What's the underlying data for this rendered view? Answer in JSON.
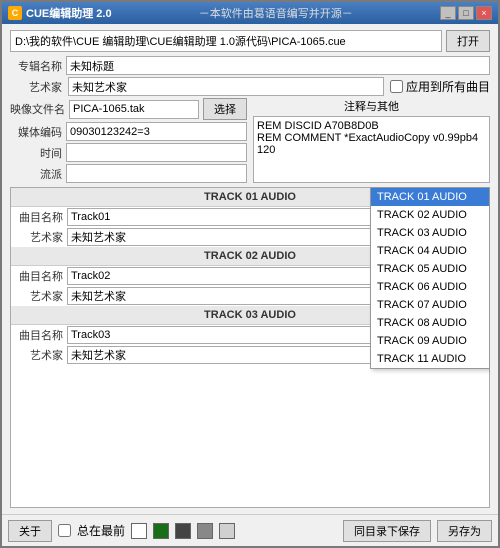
{
  "window": {
    "title": "CUE编辑助理 2.0",
    "subtitle": "－本软件由葛语音编写并开源－",
    "buttons": [
      "_",
      "□",
      "×"
    ]
  },
  "file_path": "D:\\我的软件\\CUE 编辑助理\\CUE编辑助理 1.0源代码\\PICA-1065.cue",
  "open_btn": "打开",
  "fields": {
    "album_label": "专辑名称",
    "album_value": "未知标题",
    "artist_label": "艺术家",
    "artist_value": "未知艺术家",
    "apply_label": "应用到所有曲目",
    "image_label": "映像文件名",
    "image_value": "PICA-1065.tak",
    "select_btn": "选择",
    "media_label": "媒体编码",
    "media_value": "09030123242=3",
    "notes_label": "注释与其他",
    "notes_value": "REM DISCID A70B8D0B\nREM COMMENT *ExactAudioCopy v0.99pb4\n120",
    "time_label": "时间",
    "time_value": "",
    "genre_label": "流派",
    "genre_value": ""
  },
  "tracks": [
    {
      "header": "TRACK 01 AUDIO",
      "name_label": "曲目名称",
      "name_value": "Track01",
      "artist_label": "艺术家",
      "artist_value": "未知艺术家"
    },
    {
      "header": "TRACK 02 AUDIO",
      "name_label": "曲目名称",
      "name_value": "Track02",
      "artist_label": "艺术家",
      "artist_value": "未知艺术家"
    },
    {
      "header": "TRACK 03 AUDIO",
      "name_label": "曲目名称",
      "name_value": "Track03",
      "artist_label": "艺术家",
      "artist_value": "未知艺术家"
    }
  ],
  "dropdown_items": [
    {
      "label": "TRACK 01 AUDIO",
      "selected": true
    },
    {
      "label": "TRACK 02 AUDIO",
      "selected": false
    },
    {
      "label": "TRACK 03 AUDIO",
      "selected": false
    },
    {
      "label": "TRACK 04 AUDIO",
      "selected": false
    },
    {
      "label": "TRACK 05 AUDIO",
      "selected": false
    },
    {
      "label": "TRACK 06 AUDIO",
      "selected": false
    },
    {
      "label": "TRACK 07 AUDIO",
      "selected": false
    },
    {
      "label": "TRACK 08 AUDIO",
      "selected": false
    },
    {
      "label": "TRACK 09 AUDIO",
      "selected": false
    },
    {
      "label": "TRACK 11 AUDIO",
      "selected": false
    }
  ],
  "bottom": {
    "about_btn": "关于",
    "always_front_label": "总在最前",
    "colors": [
      "#ffffff",
      "#1a6e1a",
      "#444444",
      "#888888",
      "#d0d0d0"
    ],
    "save_dir_btn": "同目录下保存",
    "save_as_btn": "另存为"
  }
}
